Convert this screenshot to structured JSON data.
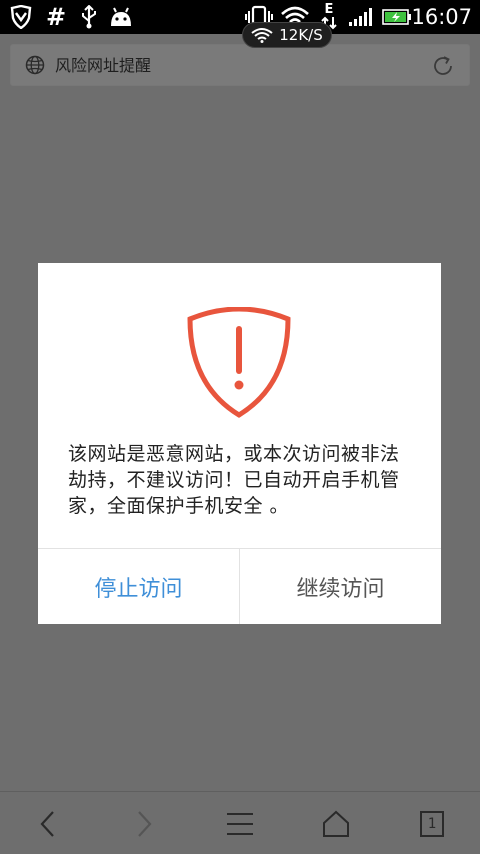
{
  "status_bar": {
    "time": "16:07",
    "network_speed": "12K/S",
    "signal_letter": "E",
    "icons": [
      "shield-icon",
      "hash-icon",
      "usb-icon",
      "android-icon",
      "vibrate-icon",
      "wifi-icon",
      "data-arrows-icon",
      "signal-icon",
      "battery-charging-icon"
    ]
  },
  "address_bar": {
    "title": "风险网址提醒",
    "left_icon": "globe-icon",
    "right_icon": "refresh-icon"
  },
  "dialog": {
    "icon": "shield-warning-icon",
    "accent": "#e8553d",
    "message": "该网站是恶意网站，或本次访问被非法劫持，不建议访问！已自动开启手机管家，全面保护手机安全 。",
    "stop_label": "停止访问",
    "continue_label": "继续访问",
    "stop_color": "#3f8fd8"
  },
  "toolbar": {
    "tab_count": "1",
    "items": [
      "back-icon",
      "forward-icon",
      "menu-icon",
      "home-icon",
      "tabs-icon"
    ]
  }
}
